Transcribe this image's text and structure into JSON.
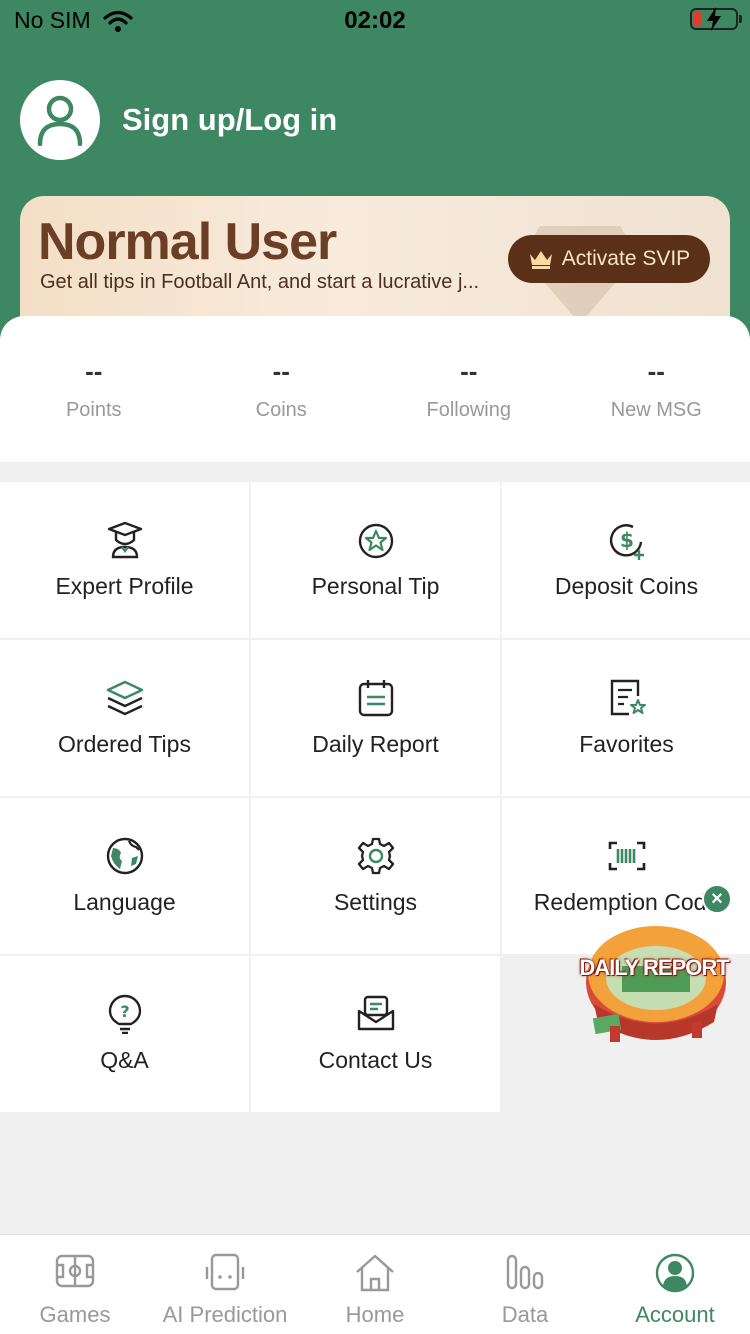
{
  "status_bar": {
    "carrier": "No SIM",
    "time": "02:02"
  },
  "header": {
    "login_label": "Sign up/Log in"
  },
  "vip": {
    "title": "Normal User",
    "subtitle": "Get all tips in Football Ant, and start a lucrative j...",
    "button": "Activate SVIP"
  },
  "stats": [
    {
      "value": "--",
      "label": "Points"
    },
    {
      "value": "--",
      "label": "Coins"
    },
    {
      "value": "--",
      "label": "Following"
    },
    {
      "value": "--",
      "label": "New MSG"
    }
  ],
  "menu": [
    {
      "label": "Expert Profile",
      "icon": "graduation-cap-icon"
    },
    {
      "label": "Personal Tip",
      "icon": "star-badge-icon"
    },
    {
      "label": "Deposit Coins",
      "icon": "dollar-coin-icon"
    },
    {
      "label": "Ordered Tips",
      "icon": "layers-icon"
    },
    {
      "label": "Daily Report",
      "icon": "calendar-report-icon"
    },
    {
      "label": "Favorites",
      "icon": "favorite-document-icon"
    },
    {
      "label": "Language",
      "icon": "globe-icon"
    },
    {
      "label": "Settings",
      "icon": "gear-icon"
    },
    {
      "label": "Redemption Code",
      "icon": "barcode-scan-icon"
    },
    {
      "label": "Q&A",
      "icon": "lightbulb-question-icon"
    },
    {
      "label": "Contact Us",
      "icon": "mail-envelope-icon"
    }
  ],
  "promo": {
    "text": "DAILY REPORT"
  },
  "tabbar": [
    {
      "label": "Games",
      "icon": "field-icon"
    },
    {
      "label": "AI Prediction",
      "icon": "robot-icon"
    },
    {
      "label": "Home",
      "icon": "home-icon"
    },
    {
      "label": "Data",
      "icon": "bar-chart-icon"
    },
    {
      "label": "Account",
      "icon": "account-icon",
      "active": true
    }
  ],
  "colors": {
    "brand": "#3d8762",
    "vip_button": "#5b3018",
    "text_muted": "#999999"
  }
}
